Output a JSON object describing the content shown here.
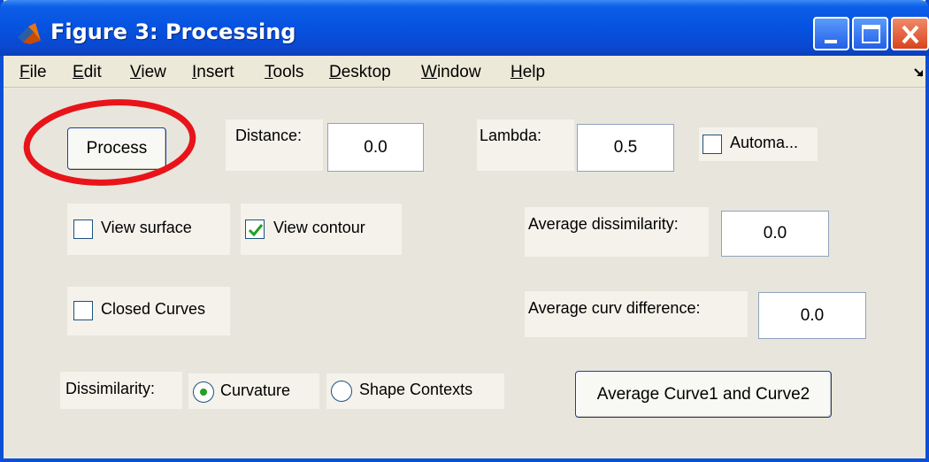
{
  "window": {
    "title": "Figure 3: Processing",
    "icon": "matlab-logo-icon"
  },
  "menu": {
    "items": [
      {
        "label": "File",
        "mnemonic": "F"
      },
      {
        "label": "Edit",
        "mnemonic": "E"
      },
      {
        "label": "View",
        "mnemonic": "V"
      },
      {
        "label": "Insert",
        "mnemonic": "I"
      },
      {
        "label": "Tools",
        "mnemonic": "T"
      },
      {
        "label": "Desktop",
        "mnemonic": "D"
      },
      {
        "label": "Window",
        "mnemonic": "W"
      },
      {
        "label": "Help",
        "mnemonic": "H"
      }
    ]
  },
  "controls": {
    "process_button": "Process",
    "distance_label": "Distance:",
    "distance_value": "0.0",
    "lambda_label": "Lambda:",
    "lambda_value": "0.5",
    "automatic_label": "Automa...",
    "automatic_checked": false,
    "view_surface_label": "View surface",
    "view_surface_checked": false,
    "view_contour_label": "View contour",
    "view_contour_checked": true,
    "avg_dissimilarity_label": "Average dissimilarity:",
    "avg_dissimilarity_value": "0.0",
    "closed_curves_label": "Closed Curves",
    "closed_curves_checked": false,
    "avg_curv_diff_label": "Average curv difference:",
    "avg_curv_diff_value": "0.0",
    "dissimilarity_label": "Dissimilarity:",
    "curvature_label": "Curvature",
    "curvature_selected": true,
    "shape_contexts_label": "Shape Contexts",
    "shape_contexts_selected": false,
    "average_curves_button": "Average Curve1 and Curve2"
  },
  "colors": {
    "titlebar": "#0552e0",
    "panel": "#e8e6dc",
    "highlight_ellipse": "#e8141a",
    "check_mark": "#21a121"
  }
}
